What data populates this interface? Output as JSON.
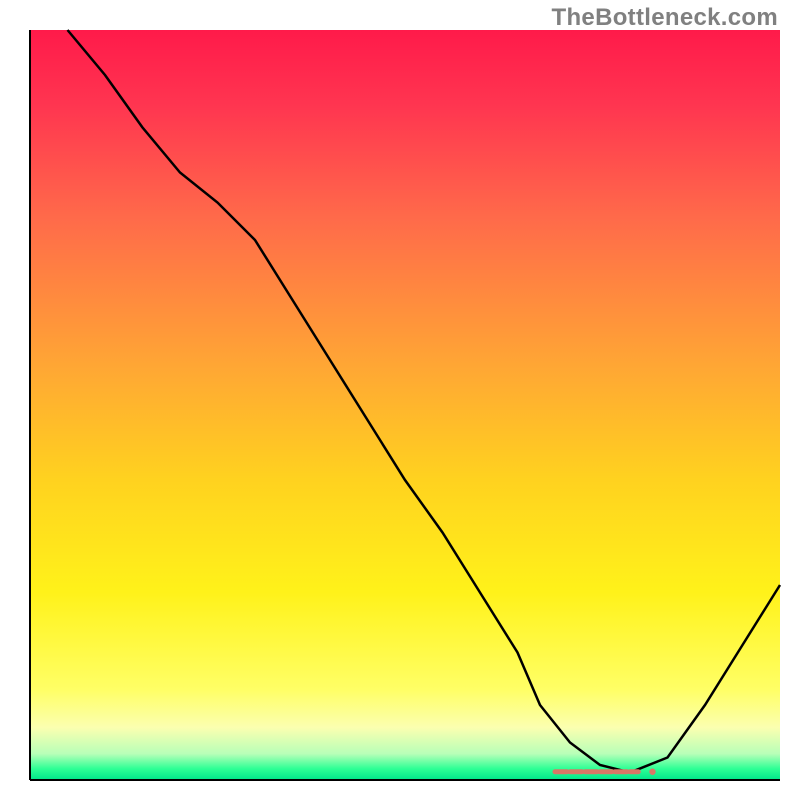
{
  "watermark": "TheBottleneck.com",
  "chart_data": {
    "type": "line",
    "title": "",
    "xlabel": "",
    "ylabel": "",
    "xlim": [
      0,
      100
    ],
    "ylim": [
      0,
      100
    ],
    "background_gradient": {
      "stops": [
        {
          "offset": 0.0,
          "color": "#ff1a4a"
        },
        {
          "offset": 0.1,
          "color": "#ff3550"
        },
        {
          "offset": 0.25,
          "color": "#ff6a4a"
        },
        {
          "offset": 0.45,
          "color": "#ffa734"
        },
        {
          "offset": 0.6,
          "color": "#ffd21f"
        },
        {
          "offset": 0.75,
          "color": "#fff21a"
        },
        {
          "offset": 0.88,
          "color": "#ffff66"
        },
        {
          "offset": 0.93,
          "color": "#fbffb0"
        },
        {
          "offset": 0.965,
          "color": "#b8ffb8"
        },
        {
          "offset": 0.985,
          "color": "#2eff95"
        },
        {
          "offset": 1.0,
          "color": "#00e58a"
        }
      ]
    },
    "series": [
      {
        "name": "bottleneck-curve",
        "type": "line",
        "color": "#000000",
        "x": [
          5,
          10,
          15,
          20,
          25,
          30,
          35,
          40,
          45,
          50,
          55,
          60,
          65,
          68,
          72,
          76,
          80,
          85,
          90,
          95,
          100
        ],
        "y": [
          100,
          94,
          87,
          81,
          77,
          72,
          64,
          56,
          48,
          40,
          33,
          25,
          17,
          10,
          5,
          2,
          1,
          3,
          10,
          18,
          26
        ]
      },
      {
        "name": "optimal-region-marker",
        "type": "line",
        "color": "#d97766",
        "stroke_width": 5,
        "x": [
          70,
          72,
          74,
          76,
          78,
          80,
          81.5
        ],
        "y": [
          1.1,
          1.1,
          1.1,
          1.1,
          1.1,
          1.1,
          1.1
        ]
      }
    ],
    "annotations": []
  }
}
